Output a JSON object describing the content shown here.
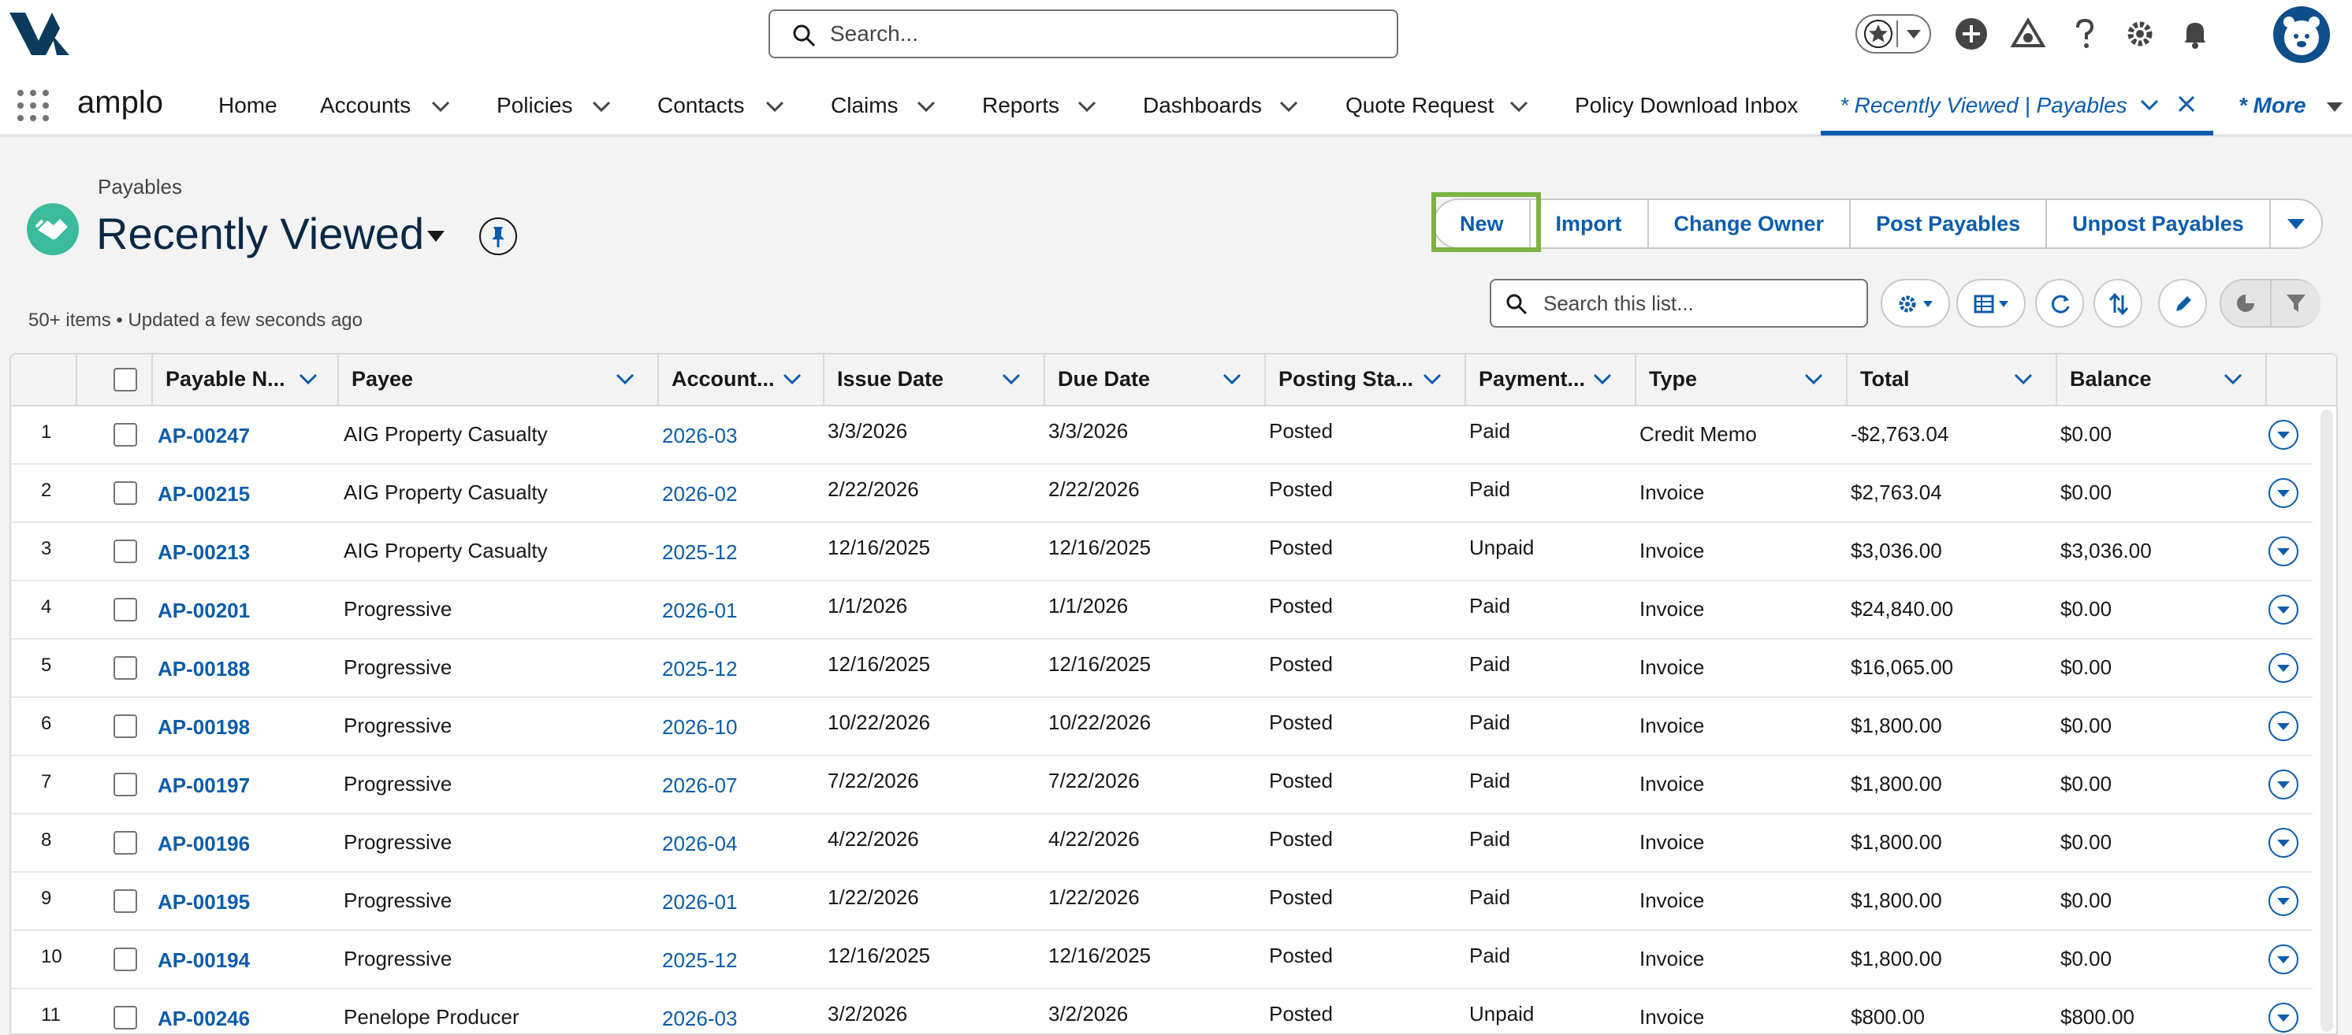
{
  "global": {
    "search_placeholder": "Search...",
    "icons": [
      "logo-icon",
      "search-icon",
      "star-icon",
      "add-icon",
      "trailhead-icon",
      "help-icon",
      "setup-gear-icon",
      "notification-bell-icon",
      "user-avatar-icon"
    ]
  },
  "nav": {
    "app_name": "amplo",
    "items": [
      {
        "label": "Home",
        "has_menu": false
      },
      {
        "label": "Accounts",
        "has_menu": true
      },
      {
        "label": "Policies",
        "has_menu": true
      },
      {
        "label": "Contacts",
        "has_menu": true
      },
      {
        "label": "Claims",
        "has_menu": true
      },
      {
        "label": "Reports",
        "has_menu": true
      },
      {
        "label": "Dashboards",
        "has_menu": true
      },
      {
        "label": "Quote Request",
        "has_menu": true
      },
      {
        "label": "Policy Download Inbox",
        "has_menu": false
      }
    ],
    "active_tab": "* Recently Viewed | Payables",
    "more": "* More"
  },
  "header": {
    "object_label": "Payables",
    "view_title": "Recently Viewed",
    "meta": "50+ items • Updated a few seconds ago",
    "accent_color": "#3bba9c",
    "buttons": [
      "New",
      "Import",
      "Change Owner",
      "Post Payables",
      "Unpost Payables"
    ],
    "highlighted_button": "New",
    "list_search_placeholder": "Search this list..."
  },
  "table": {
    "columns": [
      "Payable N...",
      "Payee",
      "Account...",
      "Issue Date",
      "Due Date",
      "Posting Sta...",
      "Payment...",
      "Type",
      "Total",
      "Balance"
    ],
    "rows": [
      {
        "n": "1",
        "name": "AP-00247",
        "payee": "AIG Property Casualty",
        "period": "2026-03",
        "issue": "3/3/2026",
        "due": "3/3/2026",
        "posting": "Posted",
        "payment": "Paid",
        "type": "Credit Memo",
        "total": "-$2,763.04",
        "balance": "$0.00"
      },
      {
        "n": "2",
        "name": "AP-00215",
        "payee": "AIG Property Casualty",
        "period": "2026-02",
        "issue": "2/22/2026",
        "due": "2/22/2026",
        "posting": "Posted",
        "payment": "Paid",
        "type": "Invoice",
        "total": "$2,763.04",
        "balance": "$0.00"
      },
      {
        "n": "3",
        "name": "AP-00213",
        "payee": "AIG Property Casualty",
        "period": "2025-12",
        "issue": "12/16/2025",
        "due": "12/16/2025",
        "posting": "Posted",
        "payment": "Unpaid",
        "type": "Invoice",
        "total": "$3,036.00",
        "balance": "$3,036.00"
      },
      {
        "n": "4",
        "name": "AP-00201",
        "payee": "Progressive",
        "period": "2026-01",
        "issue": "1/1/2026",
        "due": "1/1/2026",
        "posting": "Posted",
        "payment": "Paid",
        "type": "Invoice",
        "total": "$24,840.00",
        "balance": "$0.00"
      },
      {
        "n": "5",
        "name": "AP-00188",
        "payee": "Progressive",
        "period": "2025-12",
        "issue": "12/16/2025",
        "due": "12/16/2025",
        "posting": "Posted",
        "payment": "Paid",
        "type": "Invoice",
        "total": "$16,065.00",
        "balance": "$0.00"
      },
      {
        "n": "6",
        "name": "AP-00198",
        "payee": "Progressive",
        "period": "2026-10",
        "issue": "10/22/2026",
        "due": "10/22/2026",
        "posting": "Posted",
        "payment": "Paid",
        "type": "Invoice",
        "total": "$1,800.00",
        "balance": "$0.00"
      },
      {
        "n": "7",
        "name": "AP-00197",
        "payee": "Progressive",
        "period": "2026-07",
        "issue": "7/22/2026",
        "due": "7/22/2026",
        "posting": "Posted",
        "payment": "Paid",
        "type": "Invoice",
        "total": "$1,800.00",
        "balance": "$0.00"
      },
      {
        "n": "8",
        "name": "AP-00196",
        "payee": "Progressive",
        "period": "2026-04",
        "issue": "4/22/2026",
        "due": "4/22/2026",
        "posting": "Posted",
        "payment": "Paid",
        "type": "Invoice",
        "total": "$1,800.00",
        "balance": "$0.00"
      },
      {
        "n": "9",
        "name": "AP-00195",
        "payee": "Progressive",
        "period": "2026-01",
        "issue": "1/22/2026",
        "due": "1/22/2026",
        "posting": "Posted",
        "payment": "Paid",
        "type": "Invoice",
        "total": "$1,800.00",
        "balance": "$0.00"
      },
      {
        "n": "10",
        "name": "AP-00194",
        "payee": "Progressive",
        "period": "2025-12",
        "issue": "12/16/2025",
        "due": "12/16/2025",
        "posting": "Posted",
        "payment": "Paid",
        "type": "Invoice",
        "total": "$1,800.00",
        "balance": "$0.00"
      },
      {
        "n": "11",
        "name": "AP-00246",
        "payee": "Penelope Producer",
        "period": "2026-03",
        "issue": "3/2/2026",
        "due": "3/2/2026",
        "posting": "Posted",
        "payment": "Unpaid",
        "type": "Invoice",
        "total": "$800.00",
        "balance": "$800.00"
      }
    ]
  }
}
